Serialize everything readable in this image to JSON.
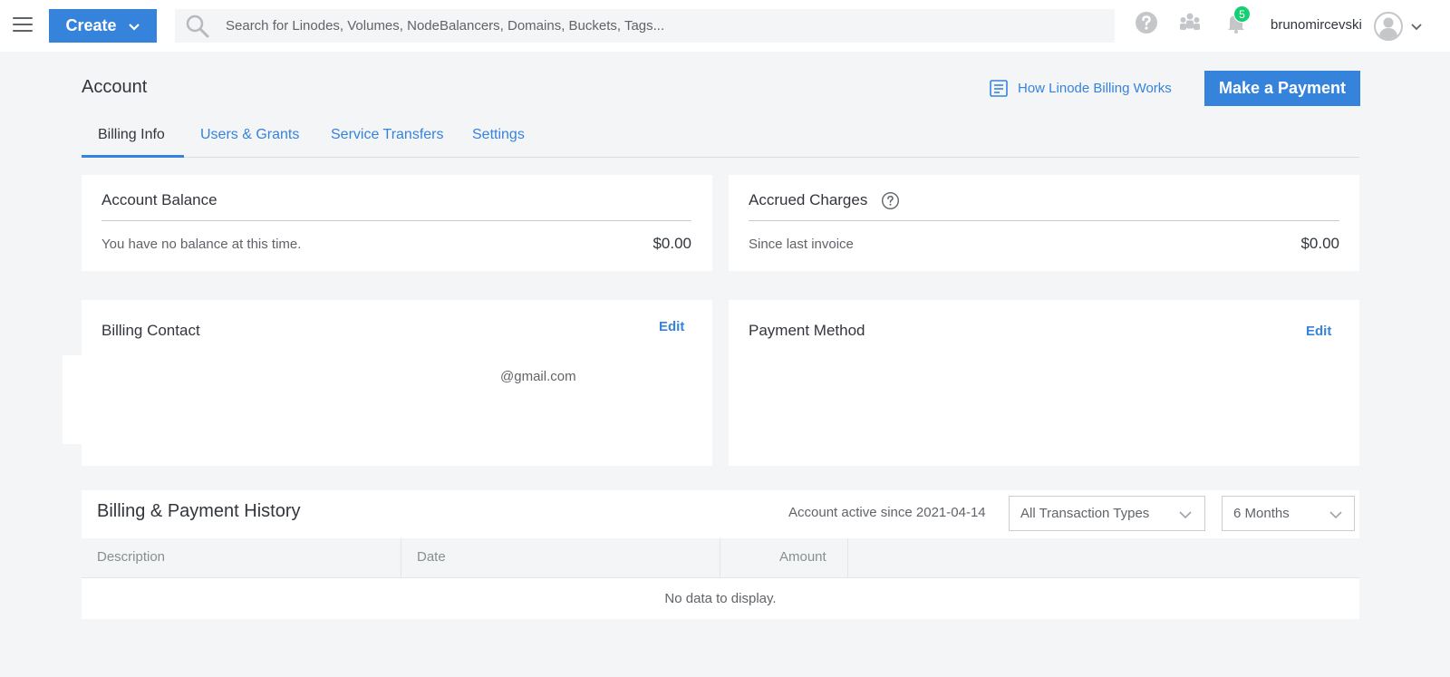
{
  "topbar": {
    "create_label": "Create",
    "search_placeholder": "Search for Linodes, Volumes, NodeBalancers, Domains, Buckets, Tags...",
    "notification_count": "5",
    "username": "brunomircevski"
  },
  "header": {
    "title": "Account",
    "doc_link": "How Linode Billing Works",
    "pay_button": "Make a Payment"
  },
  "tabs": [
    {
      "label": "Billing Info",
      "active": true
    },
    {
      "label": "Users & Grants",
      "active": false
    },
    {
      "label": "Service Transfers",
      "active": false
    },
    {
      "label": "Settings",
      "active": false
    }
  ],
  "account_balance": {
    "title": "Account Balance",
    "message": "You have no balance at this time.",
    "amount": "$0.00"
  },
  "accrued_charges": {
    "title": "Accrued Charges",
    "message": "Since last invoice",
    "amount": "$0.00"
  },
  "billing_contact": {
    "title": "Billing Contact",
    "edit_label": "Edit",
    "email": "@gmail.com"
  },
  "payment_method": {
    "title": "Payment Method",
    "edit_label": "Edit"
  },
  "history": {
    "title": "Billing & Payment History",
    "active_since": "Account active since 2021-04-14",
    "type_filter": "All Transaction Types",
    "period_filter": "6 Months",
    "columns": [
      "Description",
      "Date",
      "Amount"
    ],
    "empty_message": "No data to display."
  },
  "colors": {
    "accent": "#3683dc",
    "badge": "#17cf73",
    "background": "#f4f5f6"
  }
}
